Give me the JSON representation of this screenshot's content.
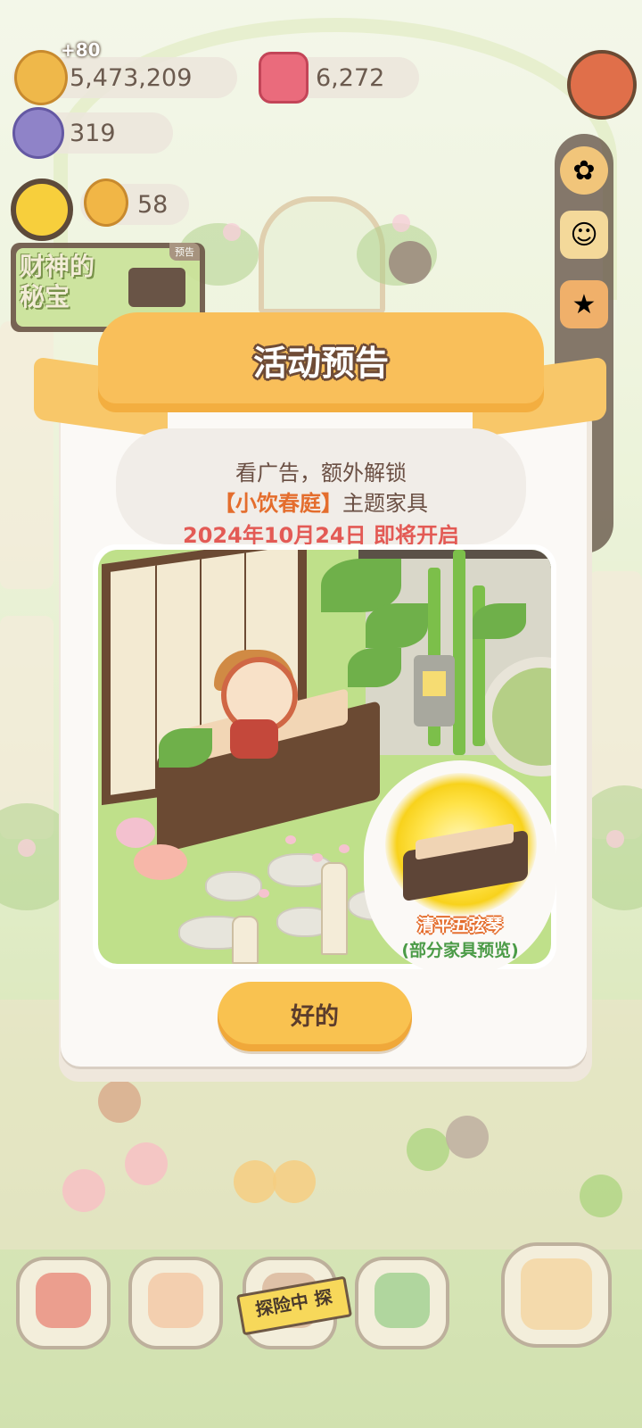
{
  "hud": {
    "coins_delta": "+80",
    "coins": "5,473,209",
    "gems": "6,272",
    "energy": "319",
    "cookies": "58"
  },
  "event_banner": {
    "text": "财神的秘宝",
    "tag": "预告"
  },
  "modal": {
    "title": "活动预告",
    "line1": "看广告，额外解锁",
    "line2_highlight": "【小饮春庭】",
    "line2_rest": "主题家具",
    "date": "2024年10月24日 即将开启",
    "item_name": "清平五弦琴",
    "item_note": "(部分家具预览)",
    "ok_label": "好的"
  },
  "nav": {
    "explore_label": "探险中 探"
  },
  "colors": {
    "ribbon": "#f9bf5a",
    "button": "#f9c250",
    "date_red": "#e35a55",
    "highlight_orange": "#e46d2d",
    "note_green": "#4b9b47"
  }
}
